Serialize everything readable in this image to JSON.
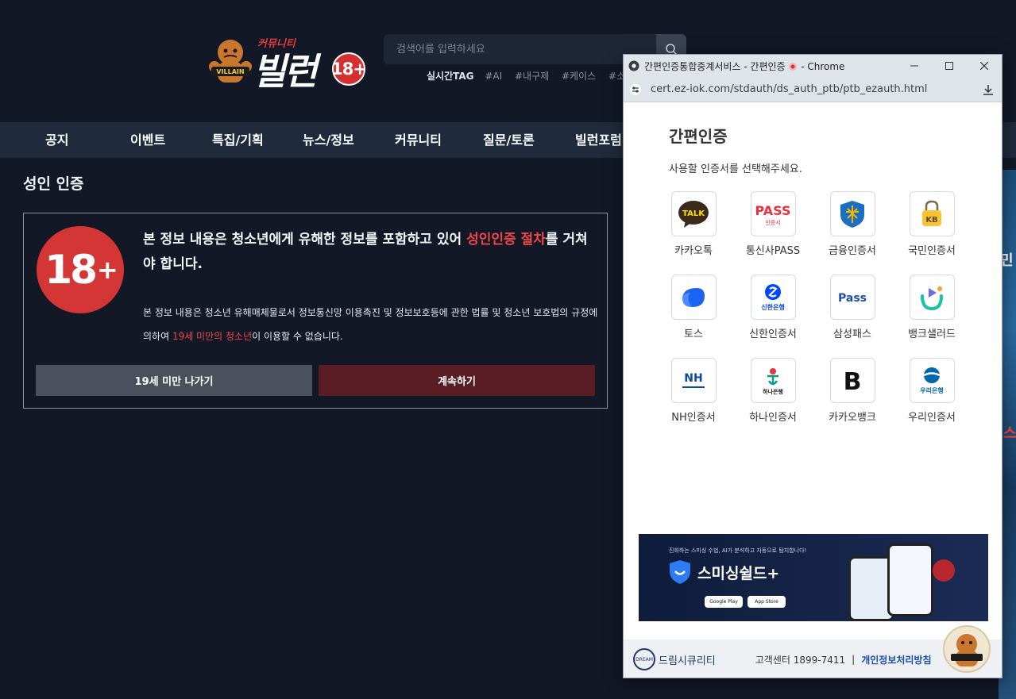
{
  "header": {
    "logo": {
      "small_text": "커뮤니티",
      "big_text": "빌런",
      "badge": "18+",
      "mascot_text": "VILLAIN"
    },
    "search": {
      "placeholder": "검색어를 입력하세요"
    },
    "tags": {
      "title": "실시간TAG",
      "items": [
        "#AI",
        "#내구제",
        "#케이스",
        "#소액"
      ]
    }
  },
  "nav": {
    "items": [
      "공지",
      "이벤트",
      "특집/기획",
      "뉴스/정보",
      "커뮤니티",
      "질문/토론",
      "빌런포럼"
    ]
  },
  "verification": {
    "section_title": "성인 인증",
    "badge_num": "18",
    "badge_plus": "+",
    "headline_pre": "본 정보 내용은 청소년에게 유해한 정보를 포함하고 있어 ",
    "headline_red": "성인인증 절차",
    "headline_post": "를 거쳐야 합니다.",
    "body_pre": "본 정보 내용은 청소년 유해매체물로서 정보통신망 이용촉진 및 정보보호등에 관한 법률 및 청소년 보호법의 규정에 의하여 ",
    "body_red": "19세 미만의 청소년",
    "body_post": "이 이용할 수 없습니다.",
    "btn_leave": "19세 미만 나가기",
    "btn_continue": "계속하기"
  },
  "side_strip": {
    "text1": "민",
    "text2": "스"
  },
  "popup": {
    "window_title": "간편인증통합중계서비스 - 간편인증",
    "browser_suffix": "- Chrome",
    "url": "cert.ez-iok.com/stdauth/ds_auth_ptb/ptb_ezauth.html",
    "title": "간편인증",
    "subtitle": "사용할 인증서를 선택해주세요.",
    "certs": [
      {
        "label": "카카오톡",
        "icon": "kakaotalk-icon",
        "mark": "TALK"
      },
      {
        "label": "통신사PASS",
        "icon": "pass-icon",
        "mark": "PASS",
        "mark2": "인증서"
      },
      {
        "label": "금융인증서",
        "icon": "financial-cert-icon"
      },
      {
        "label": "국민인증서",
        "icon": "kb-cert-icon",
        "mark": "KB"
      },
      {
        "label": "토스",
        "icon": "toss-icon"
      },
      {
        "label": "신한인증서",
        "icon": "shinhan-icon",
        "mark": "신한은행"
      },
      {
        "label": "삼성패스",
        "icon": "samsung-pass-icon",
        "mark": "Pass"
      },
      {
        "label": "뱅크샐러드",
        "icon": "banksalad-icon"
      },
      {
        "label": "NH인증서",
        "icon": "nh-icon",
        "mark": "NH"
      },
      {
        "label": "하나인증서",
        "icon": "hana-icon",
        "mark": "하나은행"
      },
      {
        "label": "카카오뱅크",
        "icon": "kakaobank-icon",
        "mark": "B"
      },
      {
        "label": "우리인증서",
        "icon": "woori-icon",
        "mark": "우리은행"
      }
    ],
    "banner": {
      "small_text": "진화하는 스미싱 수법, AI가 분석하고 자동으로 탐지합니다!",
      "name": "스미싱쉴드+",
      "store1": "Google Play",
      "store2": "App Store"
    },
    "footer": {
      "logo_text": "드림시큐리티",
      "logo_mark": "DREAM",
      "support": "고객센터 1899-7411",
      "separator": "|",
      "privacy": "개인정보처리방침"
    }
  },
  "colors": {
    "background": "#121826",
    "nav": "#1f2a3d",
    "accent_red": "#d43535",
    "continue_button": "#5a1d26",
    "leave_button": "#4a505c"
  }
}
